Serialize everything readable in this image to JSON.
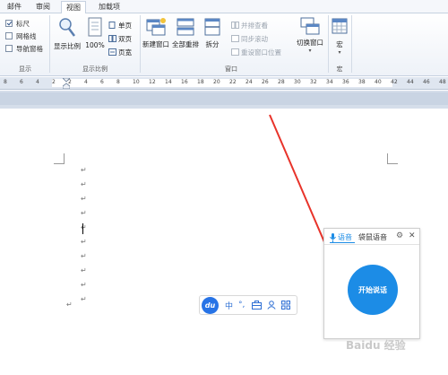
{
  "tabs": [
    {
      "label": "邮件"
    },
    {
      "label": "审阅"
    },
    {
      "label": "视图"
    },
    {
      "label": "加载项"
    }
  ],
  "show_group": {
    "items": [
      {
        "label": "标尺",
        "checked": true
      },
      {
        "label": "网格线",
        "checked": false
      },
      {
        "label": "导航窗格",
        "checked": false
      }
    ],
    "label": "显示"
  },
  "zoom_group": {
    "zoom_label": "显示比例",
    "percent_label": "100%",
    "one_page": "单页",
    "two_pages": "双页",
    "page_width": "页宽",
    "label": "显示比例"
  },
  "window_group": {
    "new_window": "新建窗口",
    "arrange_all": "全部重排",
    "split": "拆分",
    "side_by_side": "并排查看",
    "sync_scroll": "同步滚动",
    "reset_position": "重设窗口位置",
    "switch_window": "切换窗口",
    "label": "窗口"
  },
  "macro_group": {
    "macro": "宏",
    "label": "宏"
  },
  "ruler": {
    "ticks": [
      "8",
      "6",
      "4",
      "2",
      "2",
      "4",
      "6",
      "8",
      "10",
      "12",
      "14",
      "16",
      "18",
      "20",
      "22",
      "24",
      "26",
      "28",
      "30",
      "32",
      "34",
      "36",
      "38",
      "40",
      "42",
      "44",
      "46",
      "48"
    ]
  },
  "voice_panel": {
    "tab_voice": "语音",
    "tab_mouse": "袋鼠语音",
    "start_button": "开始说话"
  },
  "du_toolbar": {
    "logo": "du",
    "item_chinese": "中",
    "item_punct": "°,"
  },
  "watermark": "Baidu 经验",
  "colors": {
    "accent": "#1c8ce6",
    "arrow": "#e8332a"
  }
}
